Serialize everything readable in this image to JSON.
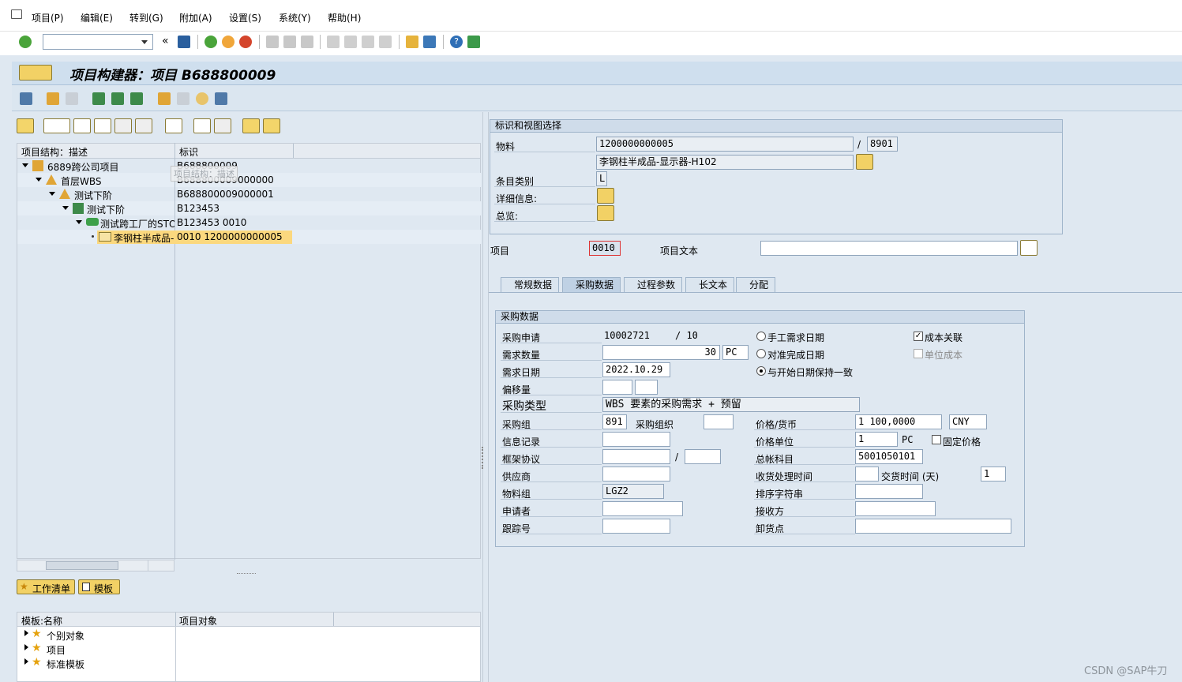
{
  "menu": [
    "项目(P)",
    "编辑(E)",
    "转到(G)",
    "附加(A)",
    "设置(S)",
    "系统(Y)",
    "帮助(H)"
  ],
  "title": "项目构建器：项目 B688800009",
  "tree": {
    "header_desc": "项目结构：描述",
    "header_id": "标识",
    "tooltip": "项目结构：描述",
    "rows": [
      {
        "desc": "6889跨公司项目",
        "id": "B688800009"
      },
      {
        "desc": "首层WBS",
        "id": "B688800009000000"
      },
      {
        "desc": "测试下阶",
        "id": "B688800009000001"
      },
      {
        "desc": "测试下阶",
        "id": "B123453"
      },
      {
        "desc": "测试跨工厂的STO",
        "id": "B123453 0010"
      },
      {
        "desc": "李钢柱半成品-",
        "id": "0010 1200000000005"
      }
    ]
  },
  "worklist_btn": "工作清单",
  "template_btn": "模板",
  "templates": {
    "header_name": "模板:名称",
    "header_obj": "项目对象",
    "items": [
      "个别对象",
      "项目",
      "标准模板"
    ]
  },
  "ident": {
    "group_title": "标识和视图选择",
    "material_label": "物料",
    "material": "1200000000005",
    "plant_sep": "/",
    "plant": "8901",
    "material_desc": "李钢柱半成品-显示器-H102",
    "item_cat_label": "条目类别",
    "item_cat": "L",
    "detail_label": "详细信息:",
    "overview_label": "总览:"
  },
  "item": {
    "label": "项目",
    "value": "0010",
    "text_label": "项目文本",
    "text_value": ""
  },
  "tabs": [
    "常规数据",
    "采购数据",
    "过程参数",
    "长文本",
    "分配"
  ],
  "purchasing": {
    "group_title": "采购数据",
    "pr_label": "采购申请",
    "pr_value": "10002721",
    "pr_item": "/ 10",
    "qty_label": "需求数量",
    "qty": "30",
    "qty_unit": "PC",
    "date_label": "需求日期",
    "date": "2022.10.29",
    "offset_label": "偏移量",
    "ptype_label": "采购类型",
    "ptype": "WBS 要素的采购需求 + 预留",
    "pgroup_label": "采购组",
    "pgroup": "891",
    "porg_label": "采购组织",
    "info_label": "信息记录",
    "frame_label": "框架协议",
    "frame_sep": "/",
    "vendor_label": "供应商",
    "matgroup_label": "物料组",
    "matgroup": "LGZ2",
    "requester_label": "申请者",
    "tracking_label": "跟踪号",
    "radio1": "手工需求日期",
    "radio2": "对准完成日期",
    "radio3": "与开始日期保持一致",
    "price_label": "价格/货币",
    "price": "1 100,0000",
    "currency": "CNY",
    "unit_label": "价格单位",
    "unit": "1",
    "unit_uom": "PC",
    "fixed_price": "固定价格",
    "gl_label": "总帐科目",
    "gl": "5001050101",
    "gr_label": "收货处理时间",
    "delivery_label": "交货时间 (天)",
    "delivery": "1",
    "sort_label": "排序字符串",
    "recipient_label": "接收方",
    "unload_label": "卸货点",
    "cost_rel": "成本关联",
    "unit_cost": "单位成本"
  },
  "watermark": "CSDN @SAP牛刀"
}
